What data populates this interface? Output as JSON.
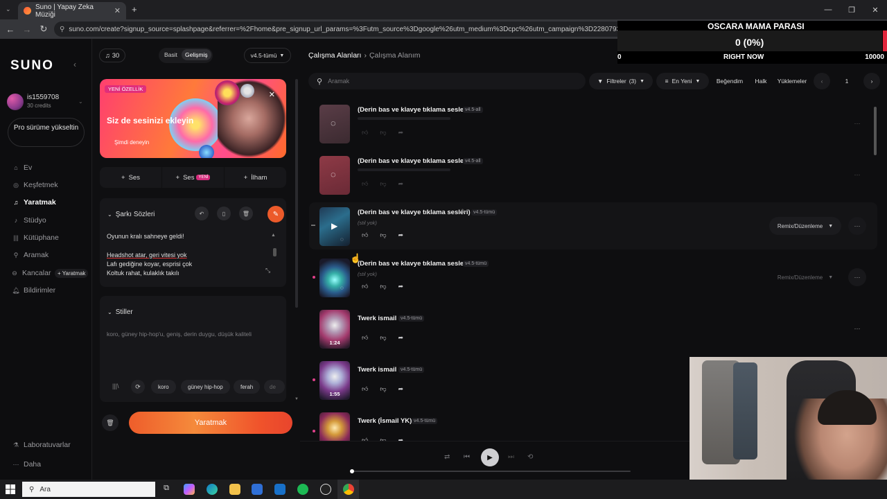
{
  "browser": {
    "tab_title": "Suno | Yapay Zeka Müziği",
    "url": "suno.com/create?signup_source=splashpage&referrer=%2Fhome&pre_signup_url_params=%3Futm_source%3Dgoogle%26utm_medium%3Dcpc%26utm_campaign%3D22807934846%26utm_term%3D%26utm_content%3D"
  },
  "overlay": {
    "title": "OSCARA MAMA PARASI",
    "value": "0 (0%)",
    "min": "0",
    "mid": "RIGHT NOW",
    "max": "10000",
    "progress": 0.0
  },
  "sidebar": {
    "logo": "SUNO",
    "username": "is1559708",
    "credits": "30 credits",
    "upgrade": "Pro sürüme yükseltin",
    "nav": [
      {
        "label": "Ev",
        "icon": "home-icon"
      },
      {
        "label": "Keşfetmek",
        "icon": "compass-icon"
      },
      {
        "label": "Yaratmak",
        "icon": "music-note-icon",
        "active": true
      },
      {
        "label": "Stüdyo",
        "icon": "studio-icon"
      },
      {
        "label": "Kütüphane",
        "icon": "library-icon"
      },
      {
        "label": "Aramak",
        "icon": "search-icon"
      },
      {
        "label": "Kancalar",
        "icon": "hook-icon"
      },
      {
        "label": "Bildirimler",
        "icon": "bell-icon"
      }
    ],
    "kancalar_create": "+ Yaratmak",
    "labs": "Laboratuvarlar",
    "more": "Daha"
  },
  "create": {
    "credits_pill": "30",
    "mode_simple": "Basit",
    "mode_advanced": "Gelişmiş",
    "version": "v4.5-tümü",
    "promo": {
      "badge": "YENİ ÖZELLİK",
      "title": "Siz de sesinizi ekleyin",
      "cta": "Şimdi deneyin"
    },
    "buttons": {
      "audio": "Ses",
      "voice": "Ses",
      "voice_badge": "YENİ",
      "inspo": "İlham"
    },
    "lyrics": {
      "header": "Şarkı Sözleri",
      "lines": [
        "Oyunun kralı sahneye geldi!",
        "",
        "Headshot atar, geri vitesi yok",
        "Lafı gediğine koyar, esprisi çok",
        "Koltuk rahat, kulaklık takılı"
      ]
    },
    "styles": {
      "header": "Stiller",
      "placeholder": "koro, güney hip-hop'u, geniş, derin duygu, düşük kaliteli",
      "chips": [
        "koro",
        "güney hip-hop",
        "ferah",
        "de"
      ]
    },
    "create_button": "Yaratmak"
  },
  "workspace": {
    "breadcrumb_root": "Çalışma Alanları",
    "breadcrumb_current": "Çalışma Alanım",
    "search_placeholder": "Aramak",
    "filters_label": "Filtreler",
    "filters_count": "(3)",
    "sort_label": "En Yeni",
    "liked": "Beğendim",
    "public": "Halk",
    "uploads": "Yüklemeler",
    "page": "1",
    "songs": [
      {
        "title": "(Derin bas ve klavye tıklama sesleri)",
        "version": "v4.5-all",
        "state": "loading",
        "thumb": "pink-loading"
      },
      {
        "title": "(Derin bas ve klavye tıklama sesleri)",
        "version": "v4.5-all",
        "state": "loading",
        "thumb": "red-loading"
      },
      {
        "title": "(Derin bas ve klavye tıklama sesleri)",
        "version": "v4.5-tümü",
        "sub": "(stil yok)",
        "state": "ready",
        "remix": "Remix/Düzenleme",
        "thumb": "keyboard-blue"
      },
      {
        "title": "(Derin bas ve klavye tıklama sesleri)",
        "version": "v4.5-tümü",
        "sub": "(stil yok)",
        "state": "ready",
        "remix": "Remix/Düzenleme",
        "thumb": "keyboard-teal"
      },
      {
        "title": "Twerk ismail",
        "version": "v4.5-tümü",
        "duration": "1:24",
        "state": "ready",
        "thumb": "discoball-pink"
      },
      {
        "title": "Twerk ismail",
        "version": "v4.5-tümü",
        "duration": "1:55",
        "state": "ready",
        "thumb": "discoball-purple"
      },
      {
        "title": "Twerk (İsmail YK)",
        "version": "v4.5-tümü",
        "state": "ready",
        "thumb": "discoball-gold"
      }
    ]
  },
  "taskbar": {
    "search": "Ara"
  },
  "colors": {
    "accent": "#ee5d2b",
    "pink": "#e0408a",
    "bg": "#101012"
  }
}
